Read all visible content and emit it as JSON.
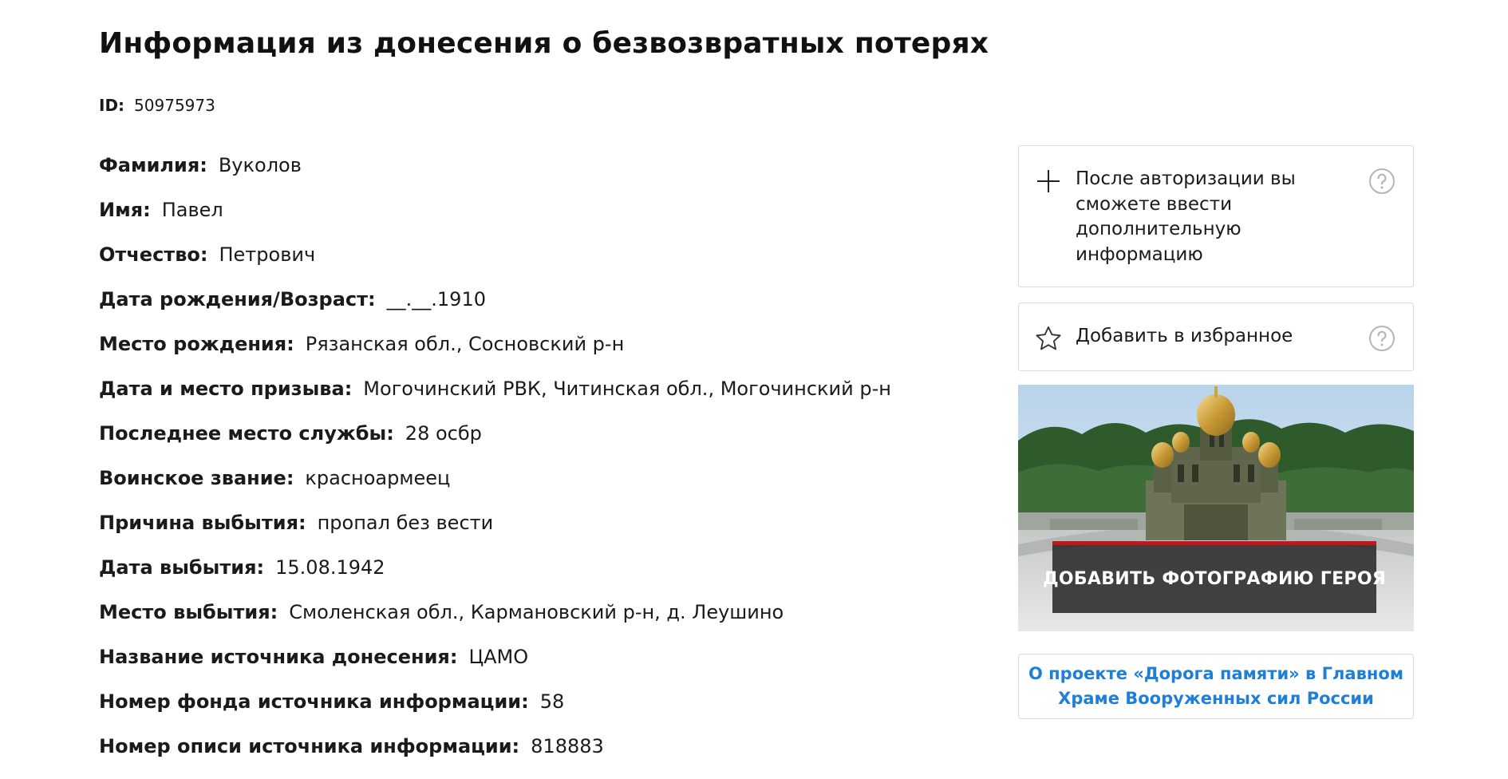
{
  "header": {
    "top_link_fragment": ""
  },
  "page": {
    "title": "Информация из донесения о безвозвратных потерях",
    "id_label": "ID:",
    "id_value": "50975973"
  },
  "fields": [
    {
      "label": "Фамилия:",
      "value": "Вуколов"
    },
    {
      "label": "Имя:",
      "value": "Павел"
    },
    {
      "label": "Отчество:",
      "value": "Петрович"
    },
    {
      "label": "Дата рождения/Возраст:",
      "value": "__.__.1910"
    },
    {
      "label": "Место рождения:",
      "value": "Рязанская обл., Сосновский р-н"
    },
    {
      "label": "Дата и место призыва:",
      "value": "Могочинский РВК, Читинская обл., Могочинский р-н"
    },
    {
      "label": "Последнее место службы:",
      "value": "28 осбр"
    },
    {
      "label": "Воинское звание:",
      "value": "красноармеец"
    },
    {
      "label": "Причина выбытия:",
      "value": "пропал без вести"
    },
    {
      "label": "Дата выбытия:",
      "value": "15.08.1942"
    },
    {
      "label": "Место выбытия:",
      "value": "Смоленская обл., Кармановский р-н, д. Леушино"
    },
    {
      "label": "Название источника донесения:",
      "value": "ЦАМО"
    },
    {
      "label": "Номер фонда источника информации:",
      "value": "58"
    },
    {
      "label": "Номер описи источника информации:",
      "value": "818883"
    }
  ],
  "sidebar": {
    "auth_card": {
      "text": "После авторизации вы сможете ввести дополнительную информацию",
      "icon": "plus-icon",
      "help_icon": "help-circle-icon"
    },
    "favorite_card": {
      "text": "Добавить в избранное",
      "icon": "star-outline-icon",
      "help_icon": "help-circle-icon"
    },
    "photo_card": {
      "button_label": "ДОБАВИТЬ ФОТОГРАФИЮ ГЕРОЯ",
      "image": "cathedral-photo"
    },
    "about_link": {
      "text": "О проекте «Дорога памяти» в Главном Храме Вооруженных сил России"
    }
  },
  "colors": {
    "accent_red": "#c0161d",
    "link_blue": "#1f7fd6",
    "border": "#dcdcdc"
  }
}
